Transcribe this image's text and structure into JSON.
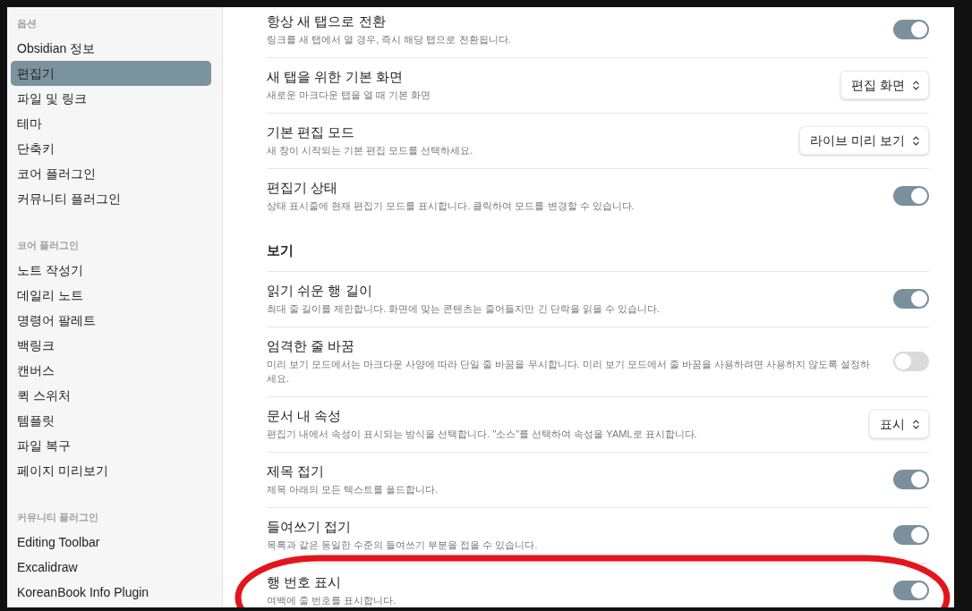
{
  "sidebar": {
    "groups": [
      {
        "heading": "옵션",
        "items": [
          {
            "label": "Obsidian 정보",
            "selected": false
          },
          {
            "label": "편집기",
            "selected": true
          },
          {
            "label": "파일 및 링크",
            "selected": false
          },
          {
            "label": "테마",
            "selected": false
          },
          {
            "label": "단축키",
            "selected": false
          },
          {
            "label": "코어 플러그인",
            "selected": false
          },
          {
            "label": "커뮤니티 플러그인",
            "selected": false
          }
        ]
      },
      {
        "heading": "코어 플러그인",
        "items": [
          {
            "label": "노트 작성기",
            "selected": false
          },
          {
            "label": "데일리 노트",
            "selected": false
          },
          {
            "label": "명령어 팔레트",
            "selected": false
          },
          {
            "label": "백링크",
            "selected": false
          },
          {
            "label": "캔버스",
            "selected": false
          },
          {
            "label": "퀵 스위처",
            "selected": false
          },
          {
            "label": "템플릿",
            "selected": false
          },
          {
            "label": "파일 복구",
            "selected": false
          },
          {
            "label": "페이지 미리보기",
            "selected": false
          }
        ]
      },
      {
        "heading": "커뮤니티 플러그인",
        "items": [
          {
            "label": "Editing Toolbar",
            "selected": false
          },
          {
            "label": "Excalidraw",
            "selected": false
          },
          {
            "label": "KoreanBook Info Plugin",
            "selected": false
          }
        ]
      }
    ]
  },
  "settings": {
    "sections": [
      {
        "rows": [
          {
            "kind": "toggle",
            "title": "항상 새 탭으로 전환",
            "description": "링크를 새 탭에서 열 경우, 즉시 해당 탭으로 전환됩니다.",
            "on": true,
            "circled": false
          },
          {
            "kind": "dropdown",
            "title": "새 탭을 위한 기본 화면",
            "description": "새로운 마크다운 탭을 열 때 기본 화면",
            "value": "편집 화면",
            "circled": false
          },
          {
            "kind": "dropdown",
            "title": "기본 편집 모드",
            "description": "새 창이 시작되는 기본 편집 모드를 선택하세요.",
            "value": "라이브 미리 보기",
            "circled": false
          },
          {
            "kind": "toggle",
            "title": "편집기 상태",
            "description": "상태 표시줄에 현재 편집기 모드를 표시합니다. 클릭하여 모드를 변경할 수 있습니다.",
            "on": true,
            "circled": false
          }
        ]
      },
      {
        "heading": "보기",
        "rows": [
          {
            "kind": "toggle",
            "title": "읽기 쉬운 행 길이",
            "description": "최대 줄 길이를 제한합니다. 화면에 맞는 콘텐츠는 줄어들지만 긴 단락을 읽을 수 있습니다.",
            "on": true,
            "circled": false
          },
          {
            "kind": "toggle",
            "title": "엄격한 줄 바꿈",
            "description": "미리 보기 모드에서는 마크다운 사양에 따라 단일 줄 바꿈을 무시합니다. 미리 보기 모드에서 줄 바꿈을 사용하려면 사용하지 않도록 설정하세요.",
            "on": false,
            "circled": false
          },
          {
            "kind": "dropdown",
            "title": "문서 내 속성",
            "description": "편집기 내에서 속성이 표시되는 방식을 선택합니다. \"소스\"를 선택하여 속성을 YAML로 표시합니다.",
            "value": "표시",
            "circled": false
          },
          {
            "kind": "toggle",
            "title": "제목 접기",
            "description": "제목 아래의 모든 텍스트를 폴드합니다.",
            "on": true,
            "circled": false
          },
          {
            "kind": "toggle",
            "title": "들여쓰기 접기",
            "description": "목록과 같은 동일한 수준의 들여쓰기 부분을 접을 수 있습니다.",
            "on": true,
            "circled": false
          },
          {
            "kind": "toggle",
            "title": "행 번호 표시",
            "description": "여백에 줄 번호를 표시합니다.",
            "on": true,
            "circled": true
          }
        ]
      }
    ]
  }
}
